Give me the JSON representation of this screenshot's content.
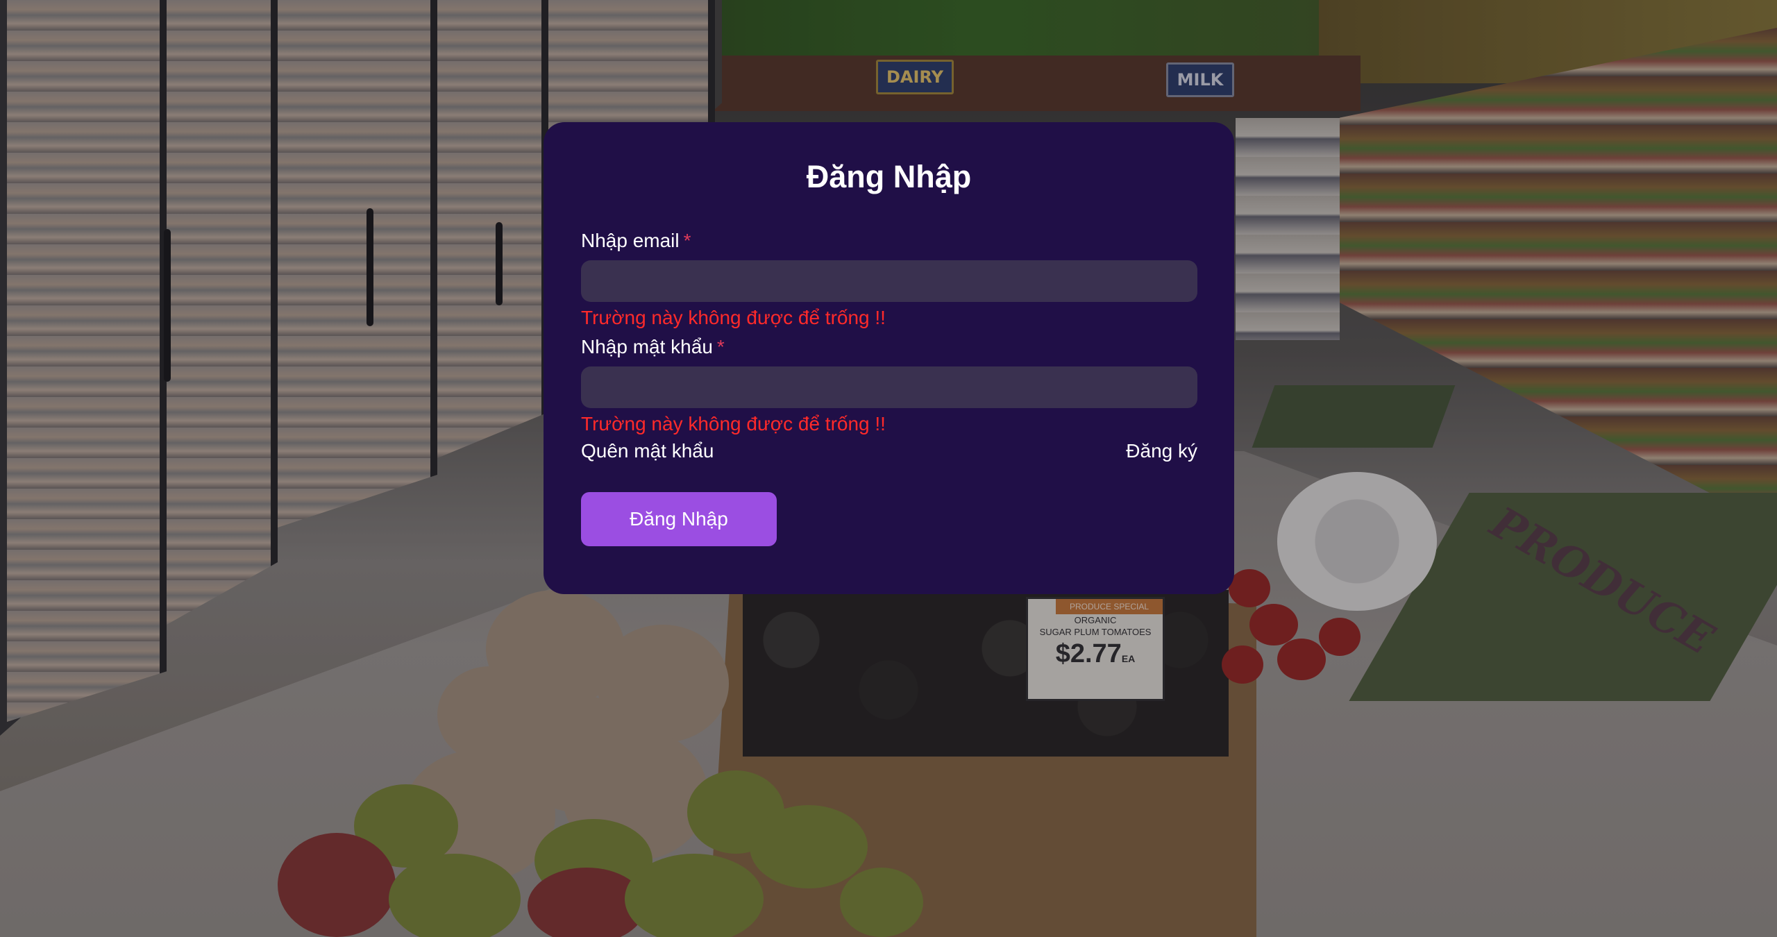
{
  "background": {
    "signs": {
      "dairy": "DAIRY",
      "milk": "MILK",
      "produce_mat": "PRODUCE"
    },
    "price_tag": {
      "header": "PRODUCE SPECIAL",
      "line1": "ORGANIC",
      "line2": "SUGAR PLUM TOMATOES",
      "price": "$2.77",
      "unit": "EA"
    }
  },
  "login": {
    "title": "Đăng Nhập",
    "email": {
      "label": "Nhập email",
      "required_mark": "*",
      "value": "",
      "error": "Trường này không được để trống !!"
    },
    "password": {
      "label": "Nhập mật khẩu",
      "required_mark": "*",
      "value": "",
      "error": "Trường này không được để trống !!"
    },
    "forgot_password": "Quên mật khẩu",
    "register": "Đăng ký",
    "submit": "Đăng Nhập"
  },
  "colors": {
    "card_background": "#200f47",
    "input_background": "#3a3150",
    "error_text": "#ff2a2a",
    "required_mark": "#e03b5a",
    "submit_button": "#9b4ee2"
  }
}
